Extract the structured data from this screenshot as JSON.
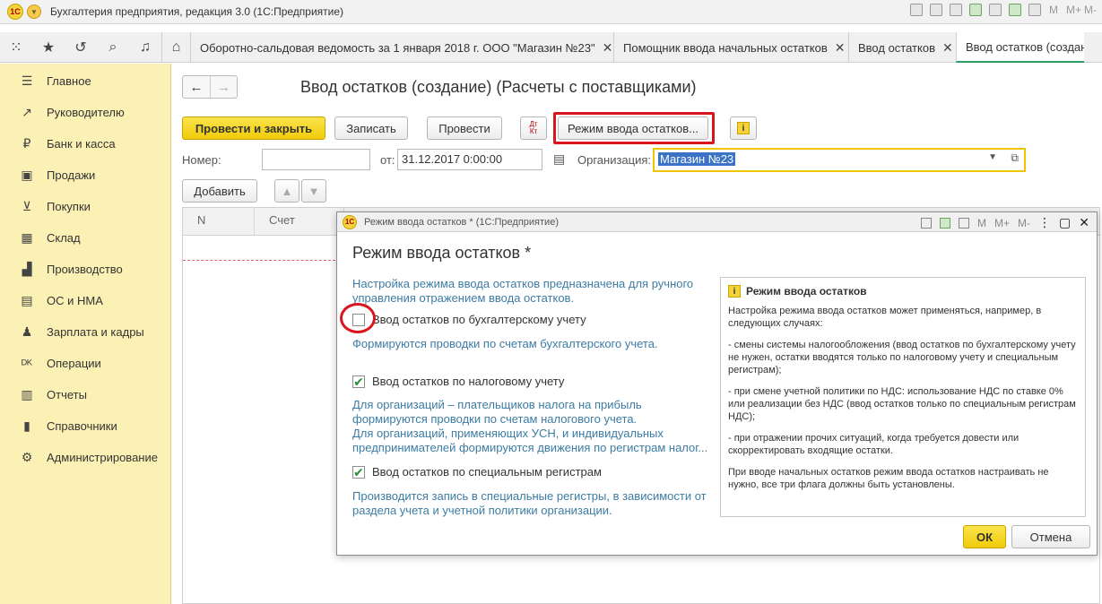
{
  "app": {
    "title": "Бухгалтерия предприятия, редакция 3.0  (1С:Предприятие)"
  },
  "titlebar_letters": [
    "M",
    "M+",
    "M-"
  ],
  "tabs": [
    {
      "label": "Оборотно-сальдовая ведомость за 1 января 2018 г. ООО \"Магазин №23\"",
      "close": "✕"
    },
    {
      "label": "Помощник ввода начальных остатков",
      "close": "✕"
    },
    {
      "label": "Ввод остатков",
      "close": "✕"
    },
    {
      "label": "Ввод остатков (создание",
      "close": ""
    }
  ],
  "sidebar": {
    "items": [
      {
        "icon": "menu-lines-icon",
        "glyph": "☰",
        "label": "Главное"
      },
      {
        "icon": "trend-icon",
        "glyph": "↗",
        "label": "Руководителю"
      },
      {
        "icon": "ruble-icon",
        "glyph": "₽",
        "label": "Банк и касса"
      },
      {
        "icon": "bag-icon",
        "glyph": "▣",
        "label": "Продажи"
      },
      {
        "icon": "cart-icon",
        "glyph": "⊻",
        "label": "Покупки"
      },
      {
        "icon": "warehouse-icon",
        "glyph": "▦",
        "label": "Склад"
      },
      {
        "icon": "factory-icon",
        "glyph": "▟",
        "label": "Производство"
      },
      {
        "icon": "assets-icon",
        "glyph": "▤",
        "label": "ОС и НМА"
      },
      {
        "icon": "people-icon",
        "glyph": "♟",
        "label": "Зарплата и кадры"
      },
      {
        "icon": "dt-kt-icon",
        "glyph": "ᴰᴷ",
        "label": "Операции"
      },
      {
        "icon": "reports-icon",
        "glyph": "▥",
        "label": "Отчеты"
      },
      {
        "icon": "book-icon",
        "glyph": "▮",
        "label": "Справочники"
      },
      {
        "icon": "gear-icon",
        "glyph": "⚙",
        "label": "Администрирование"
      }
    ]
  },
  "document": {
    "title": "Ввод остатков (создание) (Расчеты с поставщиками)",
    "toolbar": {
      "post_close": "Провести и закрыть",
      "save": "Записать",
      "post": "Провести",
      "dtkt": "Дт\nКт",
      "mode": "Режим ввода остатков...",
      "info": "i"
    },
    "number_label": "Номер:",
    "number_value": "",
    "date_label": "от:",
    "date_value": "31.12.2017  0:00:00",
    "org_label": "Организация:",
    "org_value": "Магазин №23",
    "add_button": "Добавить",
    "columns": [
      "N",
      "Счет"
    ]
  },
  "dialog": {
    "window_title": "Режим ввода остатков *  (1С:Предприятие)",
    "header": "Режим ввода остатков *",
    "intro": "Настройка режима ввода остатков предназначена для ручного управления отражением  ввода остатков.",
    "options": [
      {
        "label": "Ввод остатков по бухгалтерскому учету",
        "checked": false,
        "desc": "Формируются проводки по счетам бухгалтерского учета."
      },
      {
        "label": "Ввод остатков по налоговому учету",
        "checked": true,
        "desc": "Для организаций – плательщиков налога на прибыль формируются проводки по счетам налогового учета.\nДля организаций, применяющих УСН, и  индивидуальных предпринимателей формируются движения по регистрам налог..."
      },
      {
        "label": "Ввод остатков по специальным регистрам",
        "checked": true,
        "desc": "Производится запись в специальные регистры, в зависимости от раздела учета и учетной политики организации."
      }
    ],
    "info": {
      "title": "Режим ввода остатков",
      "paragraphs": [
        "Настройка режима ввода остатков может применяться, например, в следующих случаях:",
        "- смены системы налогообложения (ввод остатков по бухгалтерскому учету не нужен, остатки вводятся только по налоговому учету и специальным регистрам);",
        "- при смене учетной политики по НДС: использование НДС по ставке 0% или реализации без НДС (ввод остатков только по специальным регистрам НДС);",
        "- при отражении прочих ситуаций, когда требуется довести или скорректировать входящие остатки.",
        "При вводе начальных остатков режим ввода остатков настраивать не нужно, все три флага должны быть установлены."
      ]
    },
    "ok": "ОК",
    "cancel": "Отмена"
  },
  "colors": {
    "sidebar_bg": "#fcf1b4",
    "accent_yellow": "#f1cb08",
    "highlight_red": "#d9161d",
    "text_blue": "#3c7ca4"
  }
}
